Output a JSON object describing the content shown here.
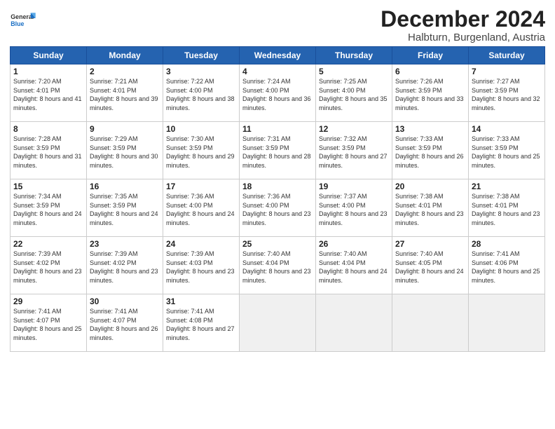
{
  "header": {
    "logo_general": "General",
    "logo_blue": "Blue",
    "month_title": "December 2024",
    "location": "Halbturn, Burgenland, Austria"
  },
  "weekdays": [
    "Sunday",
    "Monday",
    "Tuesday",
    "Wednesday",
    "Thursday",
    "Friday",
    "Saturday"
  ],
  "weeks": [
    [
      {
        "day": "1",
        "sunrise": "7:20 AM",
        "sunset": "4:01 PM",
        "daylight": "8 hours and 41 minutes."
      },
      {
        "day": "2",
        "sunrise": "7:21 AM",
        "sunset": "4:01 PM",
        "daylight": "8 hours and 39 minutes."
      },
      {
        "day": "3",
        "sunrise": "7:22 AM",
        "sunset": "4:00 PM",
        "daylight": "8 hours and 38 minutes."
      },
      {
        "day": "4",
        "sunrise": "7:24 AM",
        "sunset": "4:00 PM",
        "daylight": "8 hours and 36 minutes."
      },
      {
        "day": "5",
        "sunrise": "7:25 AM",
        "sunset": "4:00 PM",
        "daylight": "8 hours and 35 minutes."
      },
      {
        "day": "6",
        "sunrise": "7:26 AM",
        "sunset": "3:59 PM",
        "daylight": "8 hours and 33 minutes."
      },
      {
        "day": "7",
        "sunrise": "7:27 AM",
        "sunset": "3:59 PM",
        "daylight": "8 hours and 32 minutes."
      }
    ],
    [
      {
        "day": "8",
        "sunrise": "7:28 AM",
        "sunset": "3:59 PM",
        "daylight": "8 hours and 31 minutes."
      },
      {
        "day": "9",
        "sunrise": "7:29 AM",
        "sunset": "3:59 PM",
        "daylight": "8 hours and 30 minutes."
      },
      {
        "day": "10",
        "sunrise": "7:30 AM",
        "sunset": "3:59 PM",
        "daylight": "8 hours and 29 minutes."
      },
      {
        "day": "11",
        "sunrise": "7:31 AM",
        "sunset": "3:59 PM",
        "daylight": "8 hours and 28 minutes."
      },
      {
        "day": "12",
        "sunrise": "7:32 AM",
        "sunset": "3:59 PM",
        "daylight": "8 hours and 27 minutes."
      },
      {
        "day": "13",
        "sunrise": "7:33 AM",
        "sunset": "3:59 PM",
        "daylight": "8 hours and 26 minutes."
      },
      {
        "day": "14",
        "sunrise": "7:33 AM",
        "sunset": "3:59 PM",
        "daylight": "8 hours and 25 minutes."
      }
    ],
    [
      {
        "day": "15",
        "sunrise": "7:34 AM",
        "sunset": "3:59 PM",
        "daylight": "8 hours and 24 minutes."
      },
      {
        "day": "16",
        "sunrise": "7:35 AM",
        "sunset": "3:59 PM",
        "daylight": "8 hours and 24 minutes."
      },
      {
        "day": "17",
        "sunrise": "7:36 AM",
        "sunset": "4:00 PM",
        "daylight": "8 hours and 24 minutes."
      },
      {
        "day": "18",
        "sunrise": "7:36 AM",
        "sunset": "4:00 PM",
        "daylight": "8 hours and 23 minutes."
      },
      {
        "day": "19",
        "sunrise": "7:37 AM",
        "sunset": "4:00 PM",
        "daylight": "8 hours and 23 minutes."
      },
      {
        "day": "20",
        "sunrise": "7:38 AM",
        "sunset": "4:01 PM",
        "daylight": "8 hours and 23 minutes."
      },
      {
        "day": "21",
        "sunrise": "7:38 AM",
        "sunset": "4:01 PM",
        "daylight": "8 hours and 23 minutes."
      }
    ],
    [
      {
        "day": "22",
        "sunrise": "7:39 AM",
        "sunset": "4:02 PM",
        "daylight": "8 hours and 23 minutes."
      },
      {
        "day": "23",
        "sunrise": "7:39 AM",
        "sunset": "4:02 PM",
        "daylight": "8 hours and 23 minutes."
      },
      {
        "day": "24",
        "sunrise": "7:39 AM",
        "sunset": "4:03 PM",
        "daylight": "8 hours and 23 minutes."
      },
      {
        "day": "25",
        "sunrise": "7:40 AM",
        "sunset": "4:04 PM",
        "daylight": "8 hours and 23 minutes."
      },
      {
        "day": "26",
        "sunrise": "7:40 AM",
        "sunset": "4:04 PM",
        "daylight": "8 hours and 24 minutes."
      },
      {
        "day": "27",
        "sunrise": "7:40 AM",
        "sunset": "4:05 PM",
        "daylight": "8 hours and 24 minutes."
      },
      {
        "day": "28",
        "sunrise": "7:41 AM",
        "sunset": "4:06 PM",
        "daylight": "8 hours and 25 minutes."
      }
    ],
    [
      {
        "day": "29",
        "sunrise": "7:41 AM",
        "sunset": "4:07 PM",
        "daylight": "8 hours and 25 minutes."
      },
      {
        "day": "30",
        "sunrise": "7:41 AM",
        "sunset": "4:07 PM",
        "daylight": "8 hours and 26 minutes."
      },
      {
        "day": "31",
        "sunrise": "7:41 AM",
        "sunset": "4:08 PM",
        "daylight": "8 hours and 27 minutes."
      },
      null,
      null,
      null,
      null
    ]
  ]
}
